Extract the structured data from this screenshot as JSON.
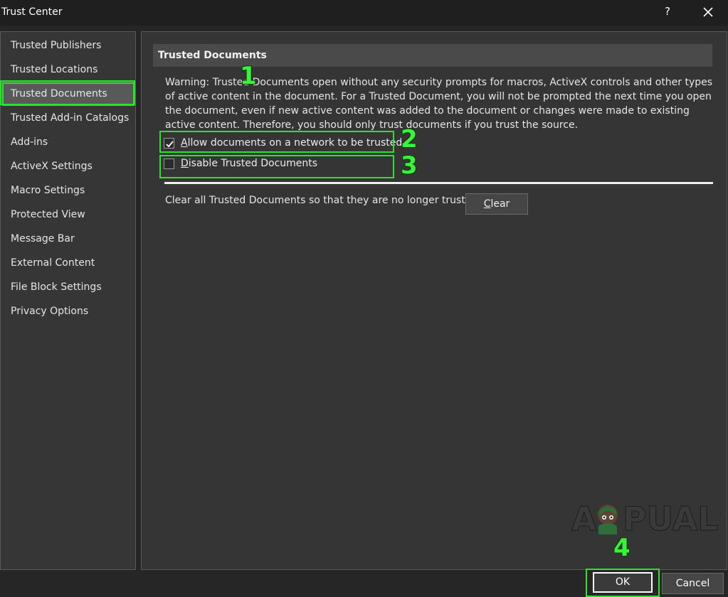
{
  "window": {
    "title": "Trust Center",
    "help_label": "?",
    "close_icon": "close-icon"
  },
  "sidebar": {
    "items": [
      {
        "label": "Trusted Publishers"
      },
      {
        "label": "Trusted Locations"
      },
      {
        "label": "Trusted Documents",
        "selected": true
      },
      {
        "label": "Trusted Add-in Catalogs"
      },
      {
        "label": "Add-ins"
      },
      {
        "label": "ActiveX Settings"
      },
      {
        "label": "Macro Settings"
      },
      {
        "label": "Protected View"
      },
      {
        "label": "Message Bar"
      },
      {
        "label": "External Content"
      },
      {
        "label": "File Block Settings"
      },
      {
        "label": "Privacy Options"
      }
    ]
  },
  "main": {
    "section_title": "Trusted Documents",
    "warning_text": "Warning: Trusted Documents open without any security prompts for macros, ActiveX controls and other types of active content in the document.  For a Trusted Document, you will not be prompted the next time you open the document, even if new active content was added to the document or changes were made to existing active content. Therefore, you should only trust documents if you trust the source.",
    "allow_network": {
      "accel": "A",
      "rest": "llow documents on a network to be trusted",
      "checked": true
    },
    "disable_trusted": {
      "accel": "D",
      "rest": "isable Trusted Documents",
      "checked": false
    },
    "clear_text": "Clear all Trusted Documents so that they are no longer trusted",
    "clear_button": {
      "accel": "C",
      "rest": "lear"
    }
  },
  "footer": {
    "ok_label": "OK",
    "cancel_label": "Cancel"
  },
  "callouts": [
    "1",
    "2",
    "3",
    "4"
  ],
  "watermark": {
    "text": "APPUALS"
  },
  "colors": {
    "highlight": "#27e627",
    "background": "#262626",
    "panel": "#353535"
  }
}
